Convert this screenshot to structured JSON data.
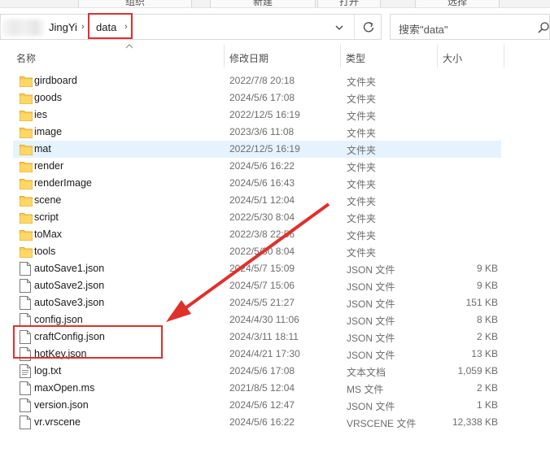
{
  "ribbon": {
    "group1": "组织",
    "group2": "新建",
    "group3": "打开",
    "group4": "选择"
  },
  "address": {
    "parent_crumb": "JingYi",
    "current_crumb": "data",
    "separator": "›"
  },
  "search": {
    "placeholder": "搜索\"data\""
  },
  "columns": {
    "name": "名称",
    "date": "修改日期",
    "type": "类型",
    "size": "大小"
  },
  "files": [
    {
      "name": "girdboard",
      "date": "2022/7/8 20:18",
      "type": "文件夹",
      "size": "",
      "icon": "folder-icon"
    },
    {
      "name": "goods",
      "date": "2024/5/6 17:08",
      "type": "文件夹",
      "size": "",
      "icon": "folder-icon"
    },
    {
      "name": "ies",
      "date": "2022/12/5 16:19",
      "type": "文件夹",
      "size": "",
      "icon": "folder-icon"
    },
    {
      "name": "image",
      "date": "2023/3/6 11:08",
      "type": "文件夹",
      "size": "",
      "icon": "folder-icon"
    },
    {
      "name": "mat",
      "date": "2022/12/5 16:19",
      "type": "文件夹",
      "size": "",
      "icon": "folder-icon",
      "selected": true
    },
    {
      "name": "render",
      "date": "2024/5/6 16:22",
      "type": "文件夹",
      "size": "",
      "icon": "folder-icon"
    },
    {
      "name": "renderImage",
      "date": "2024/5/6 16:43",
      "type": "文件夹",
      "size": "",
      "icon": "folder-icon"
    },
    {
      "name": "scene",
      "date": "2024/5/1 12:04",
      "type": "文件夹",
      "size": "",
      "icon": "folder-icon"
    },
    {
      "name": "script",
      "date": "2022/5/30 8:04",
      "type": "文件夹",
      "size": "",
      "icon": "folder-icon"
    },
    {
      "name": "toMax",
      "date": "2022/3/8 22:56",
      "type": "文件夹",
      "size": "",
      "icon": "folder-icon"
    },
    {
      "name": "tools",
      "date": "2022/5/30 8:04",
      "type": "文件夹",
      "size": "",
      "icon": "folder-icon"
    },
    {
      "name": "autoSave1.json",
      "date": "2024/5/7 15:09",
      "type": "JSON 文件",
      "size": "9 KB",
      "icon": "file-icon"
    },
    {
      "name": "autoSave2.json",
      "date": "2024/5/7 15:06",
      "type": "JSON 文件",
      "size": "9 KB",
      "icon": "file-icon"
    },
    {
      "name": "autoSave3.json",
      "date": "2024/5/5 21:27",
      "type": "JSON 文件",
      "size": "151 KB",
      "icon": "file-icon"
    },
    {
      "name": "config.json",
      "date": "2024/4/30 11:06",
      "type": "JSON 文件",
      "size": "8 KB",
      "icon": "file-icon"
    },
    {
      "name": "craftConfig.json",
      "date": "2024/3/11 18:11",
      "type": "JSON 文件",
      "size": "2 KB",
      "icon": "file-icon"
    },
    {
      "name": "hotKey.json",
      "date": "2024/4/21 17:30",
      "type": "JSON 文件",
      "size": "13 KB",
      "icon": "file-icon"
    },
    {
      "name": "log.txt",
      "date": "2024/5/6 17:08",
      "type": "文本文档",
      "size": "1,059 KB",
      "icon": "text-file-icon"
    },
    {
      "name": "maxOpen.ms",
      "date": "2021/8/5 12:04",
      "type": "MS 文件",
      "size": "2 KB",
      "icon": "file-icon"
    },
    {
      "name": "version.json",
      "date": "2024/5/6 12:47",
      "type": "JSON 文件",
      "size": "1 KB",
      "icon": "file-icon"
    },
    {
      "name": "vr.vrscene",
      "date": "2024/5/6 16:22",
      "type": "VRSCENE 文件",
      "size": "12,338 KB",
      "icon": "file-icon"
    }
  ],
  "colors": {
    "annotation_red": "#e0302b",
    "selection": "#e5f3ff",
    "folder": "#ffcc4d"
  }
}
